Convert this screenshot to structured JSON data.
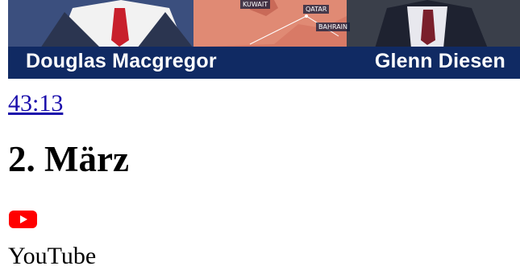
{
  "video": {
    "thumbnail": {
      "left_person": "Douglas Macgregor",
      "right_person": "Glenn Diesen",
      "map_labels": [
        "KUWAIT",
        "QATAR",
        "BAHRAIN"
      ]
    },
    "duration": "43:13",
    "date": "2. März",
    "source_icon": "youtube-icon",
    "source": "YouTube"
  },
  "colors": {
    "caption_bar": "#102a63",
    "link": "#1a0dab",
    "youtube_red": "#ff0000"
  }
}
